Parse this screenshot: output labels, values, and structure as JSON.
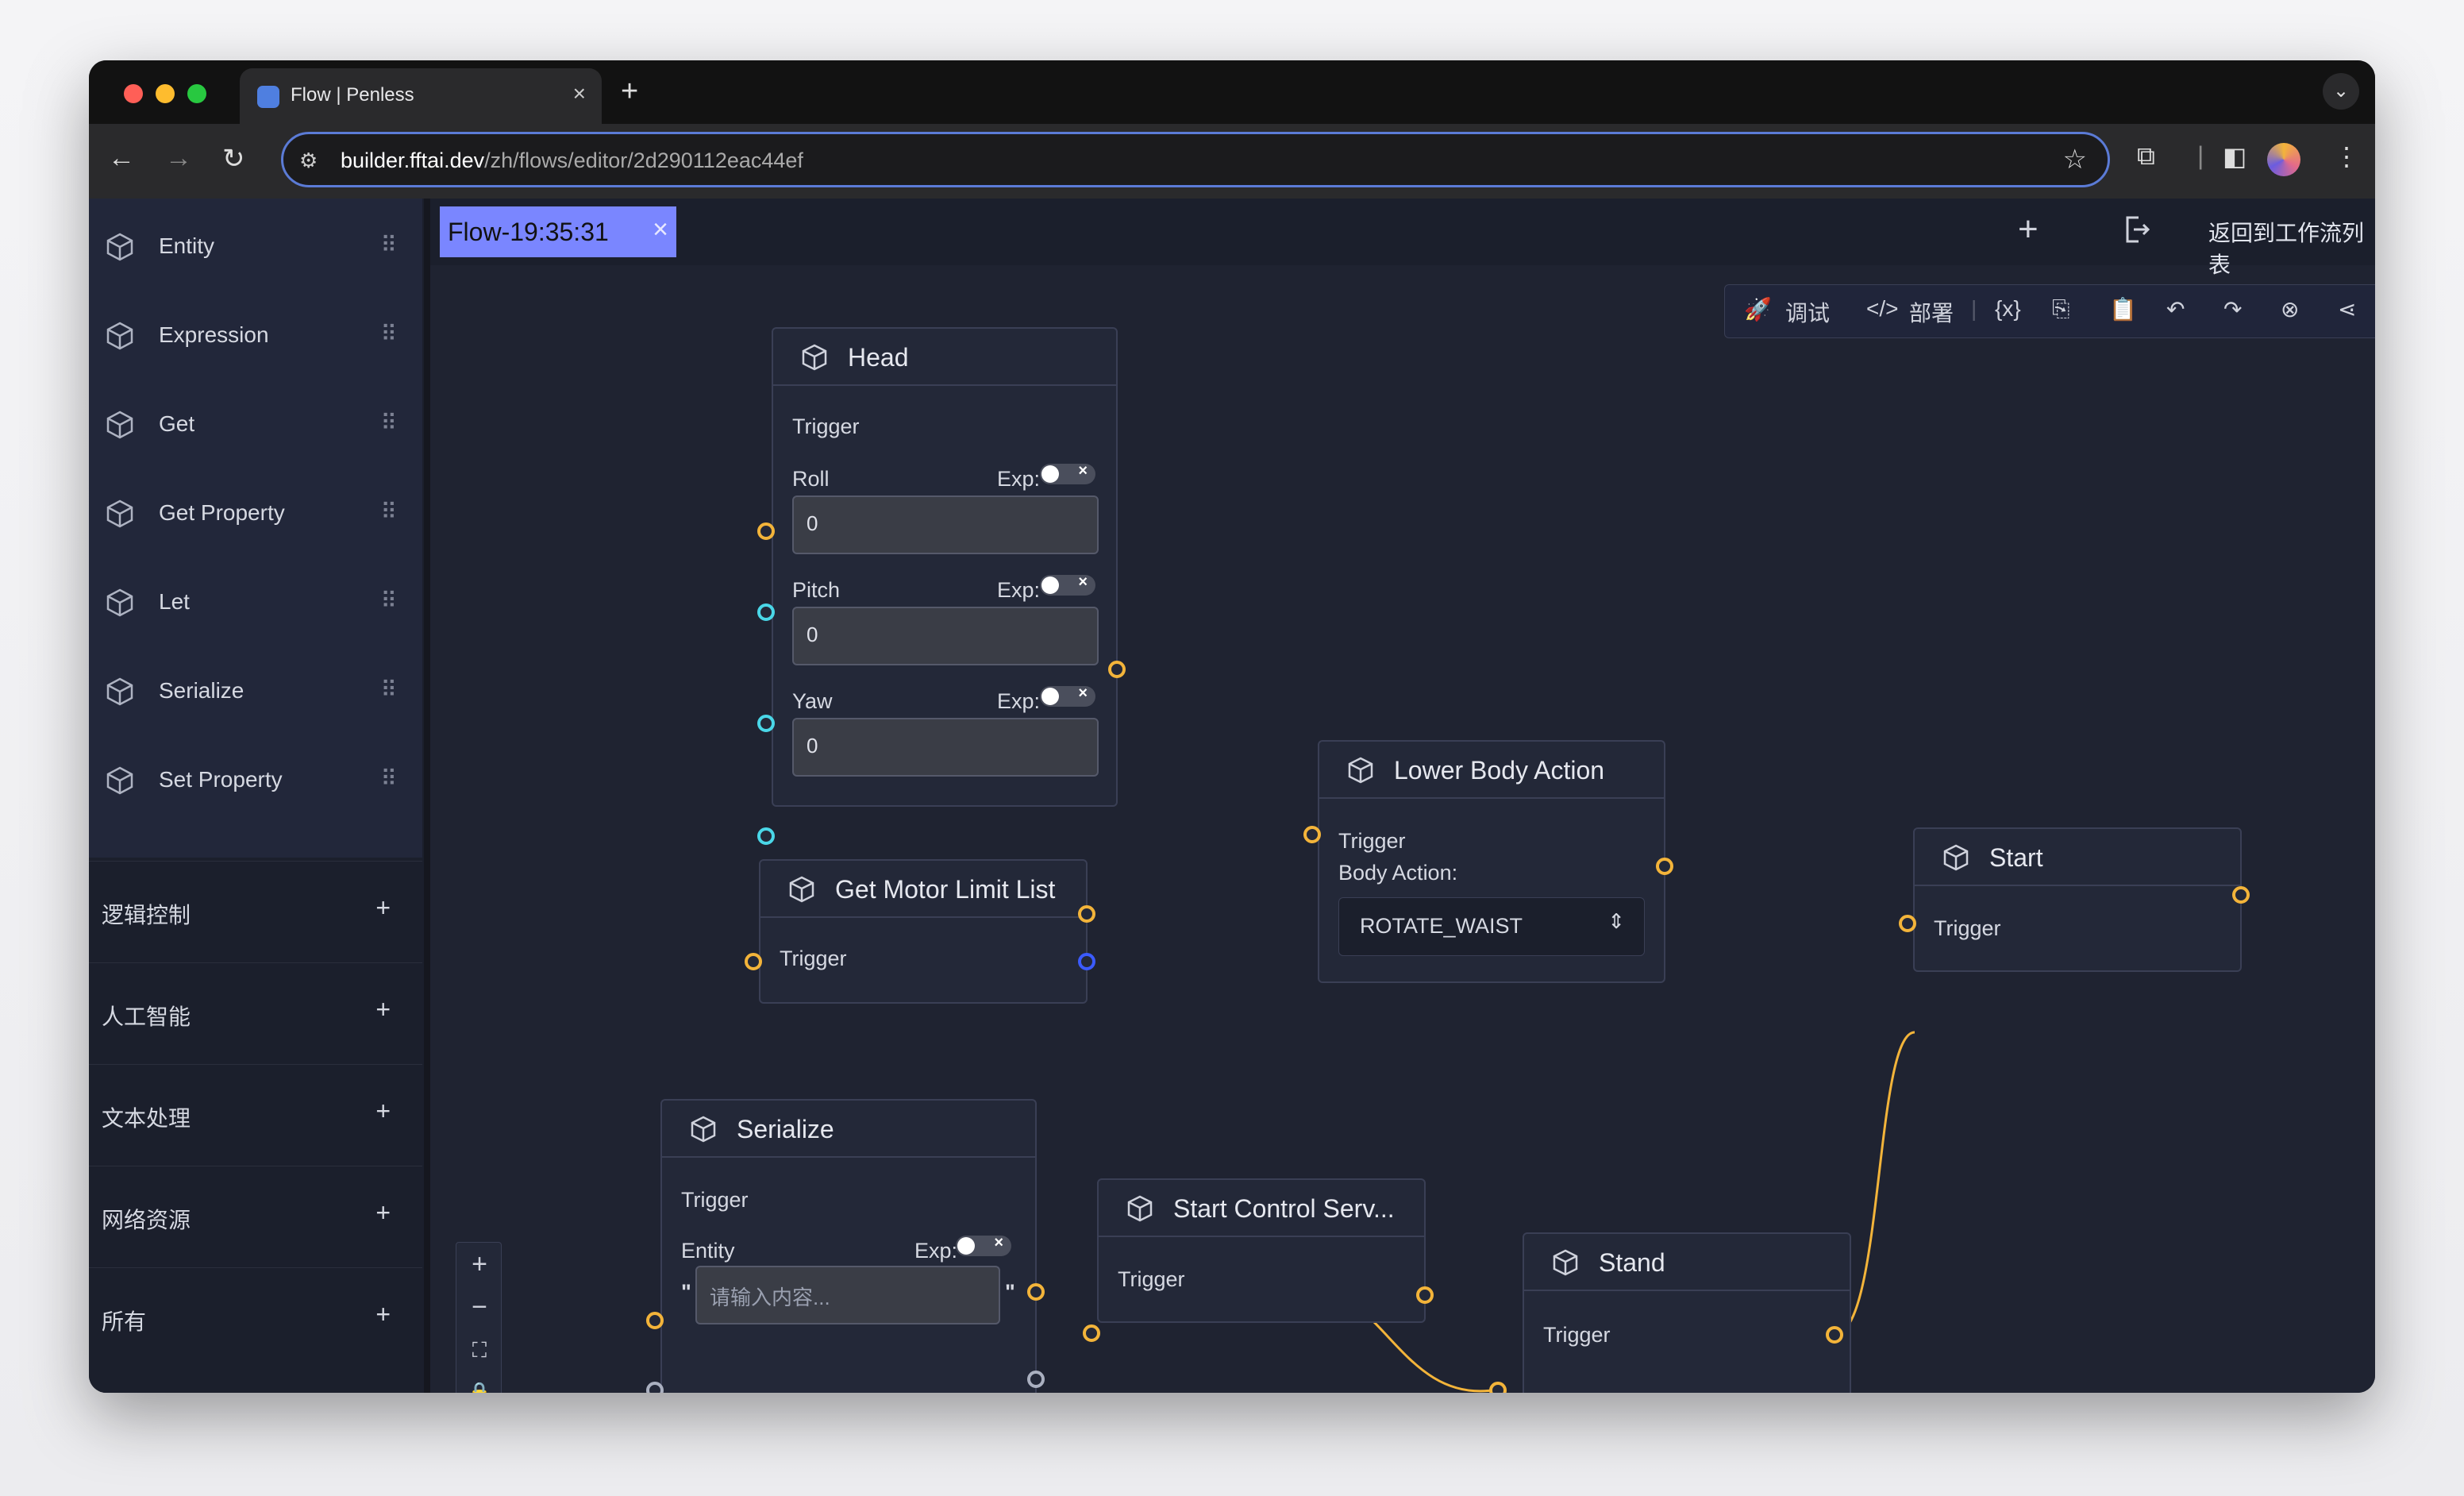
{
  "browser": {
    "tab_title": "Flow | Penless",
    "url_host": "builder.fftai.dev",
    "url_path": "/zh/flows/editor/2d290112eac44ef"
  },
  "sidebar": {
    "items": [
      {
        "label": "Entity"
      },
      {
        "label": "Expression"
      },
      {
        "label": "Get"
      },
      {
        "label": "Get Property"
      },
      {
        "label": "Let"
      },
      {
        "label": "Serialize"
      },
      {
        "label": "Set Property"
      }
    ],
    "sections": [
      {
        "label": "逻辑控制"
      },
      {
        "label": "人工智能"
      },
      {
        "label": "文本处理"
      },
      {
        "label": "网络资源"
      },
      {
        "label": "所有"
      }
    ]
  },
  "editor": {
    "flow_tab": "Flow-19:35:31",
    "back_label": "返回到工作流列表",
    "toolbar": {
      "debug_label": "调试",
      "deploy_label": "部署",
      "variables_label": "{x}"
    }
  },
  "nodes": {
    "head": {
      "title": "Head",
      "trigger": "Trigger",
      "exp_label": "Exp:",
      "fields": [
        {
          "label": "Roll",
          "value": "0"
        },
        {
          "label": "Pitch",
          "value": "0"
        },
        {
          "label": "Yaw",
          "value": "0"
        }
      ]
    },
    "get_motor": {
      "title": "Get Motor Limit List",
      "trigger": "Trigger"
    },
    "lower_body": {
      "title": "Lower Body Action",
      "trigger": "Trigger",
      "body_action_label": "Body Action:",
      "body_action_value": "ROTATE_WAIST"
    },
    "start": {
      "title": "Start",
      "trigger": "Trigger"
    },
    "serialize": {
      "title": "Serialize",
      "trigger": "Trigger",
      "entity_label": "Entity",
      "exp_label": "Exp:",
      "placeholder": "请输入内容...",
      "quote_open": "\"",
      "quote_close": "\""
    },
    "start_control": {
      "title": "Start Control Serv...",
      "trigger": "Trigger"
    },
    "stand": {
      "title": "Stand",
      "trigger": "Trigger"
    }
  },
  "colors": {
    "accent_tab": "#7a86ff",
    "port_orange": "#f3b43a",
    "port_cyan": "#4ad7e8",
    "port_blue": "#3b5bff",
    "edge": "#f3b43a"
  }
}
